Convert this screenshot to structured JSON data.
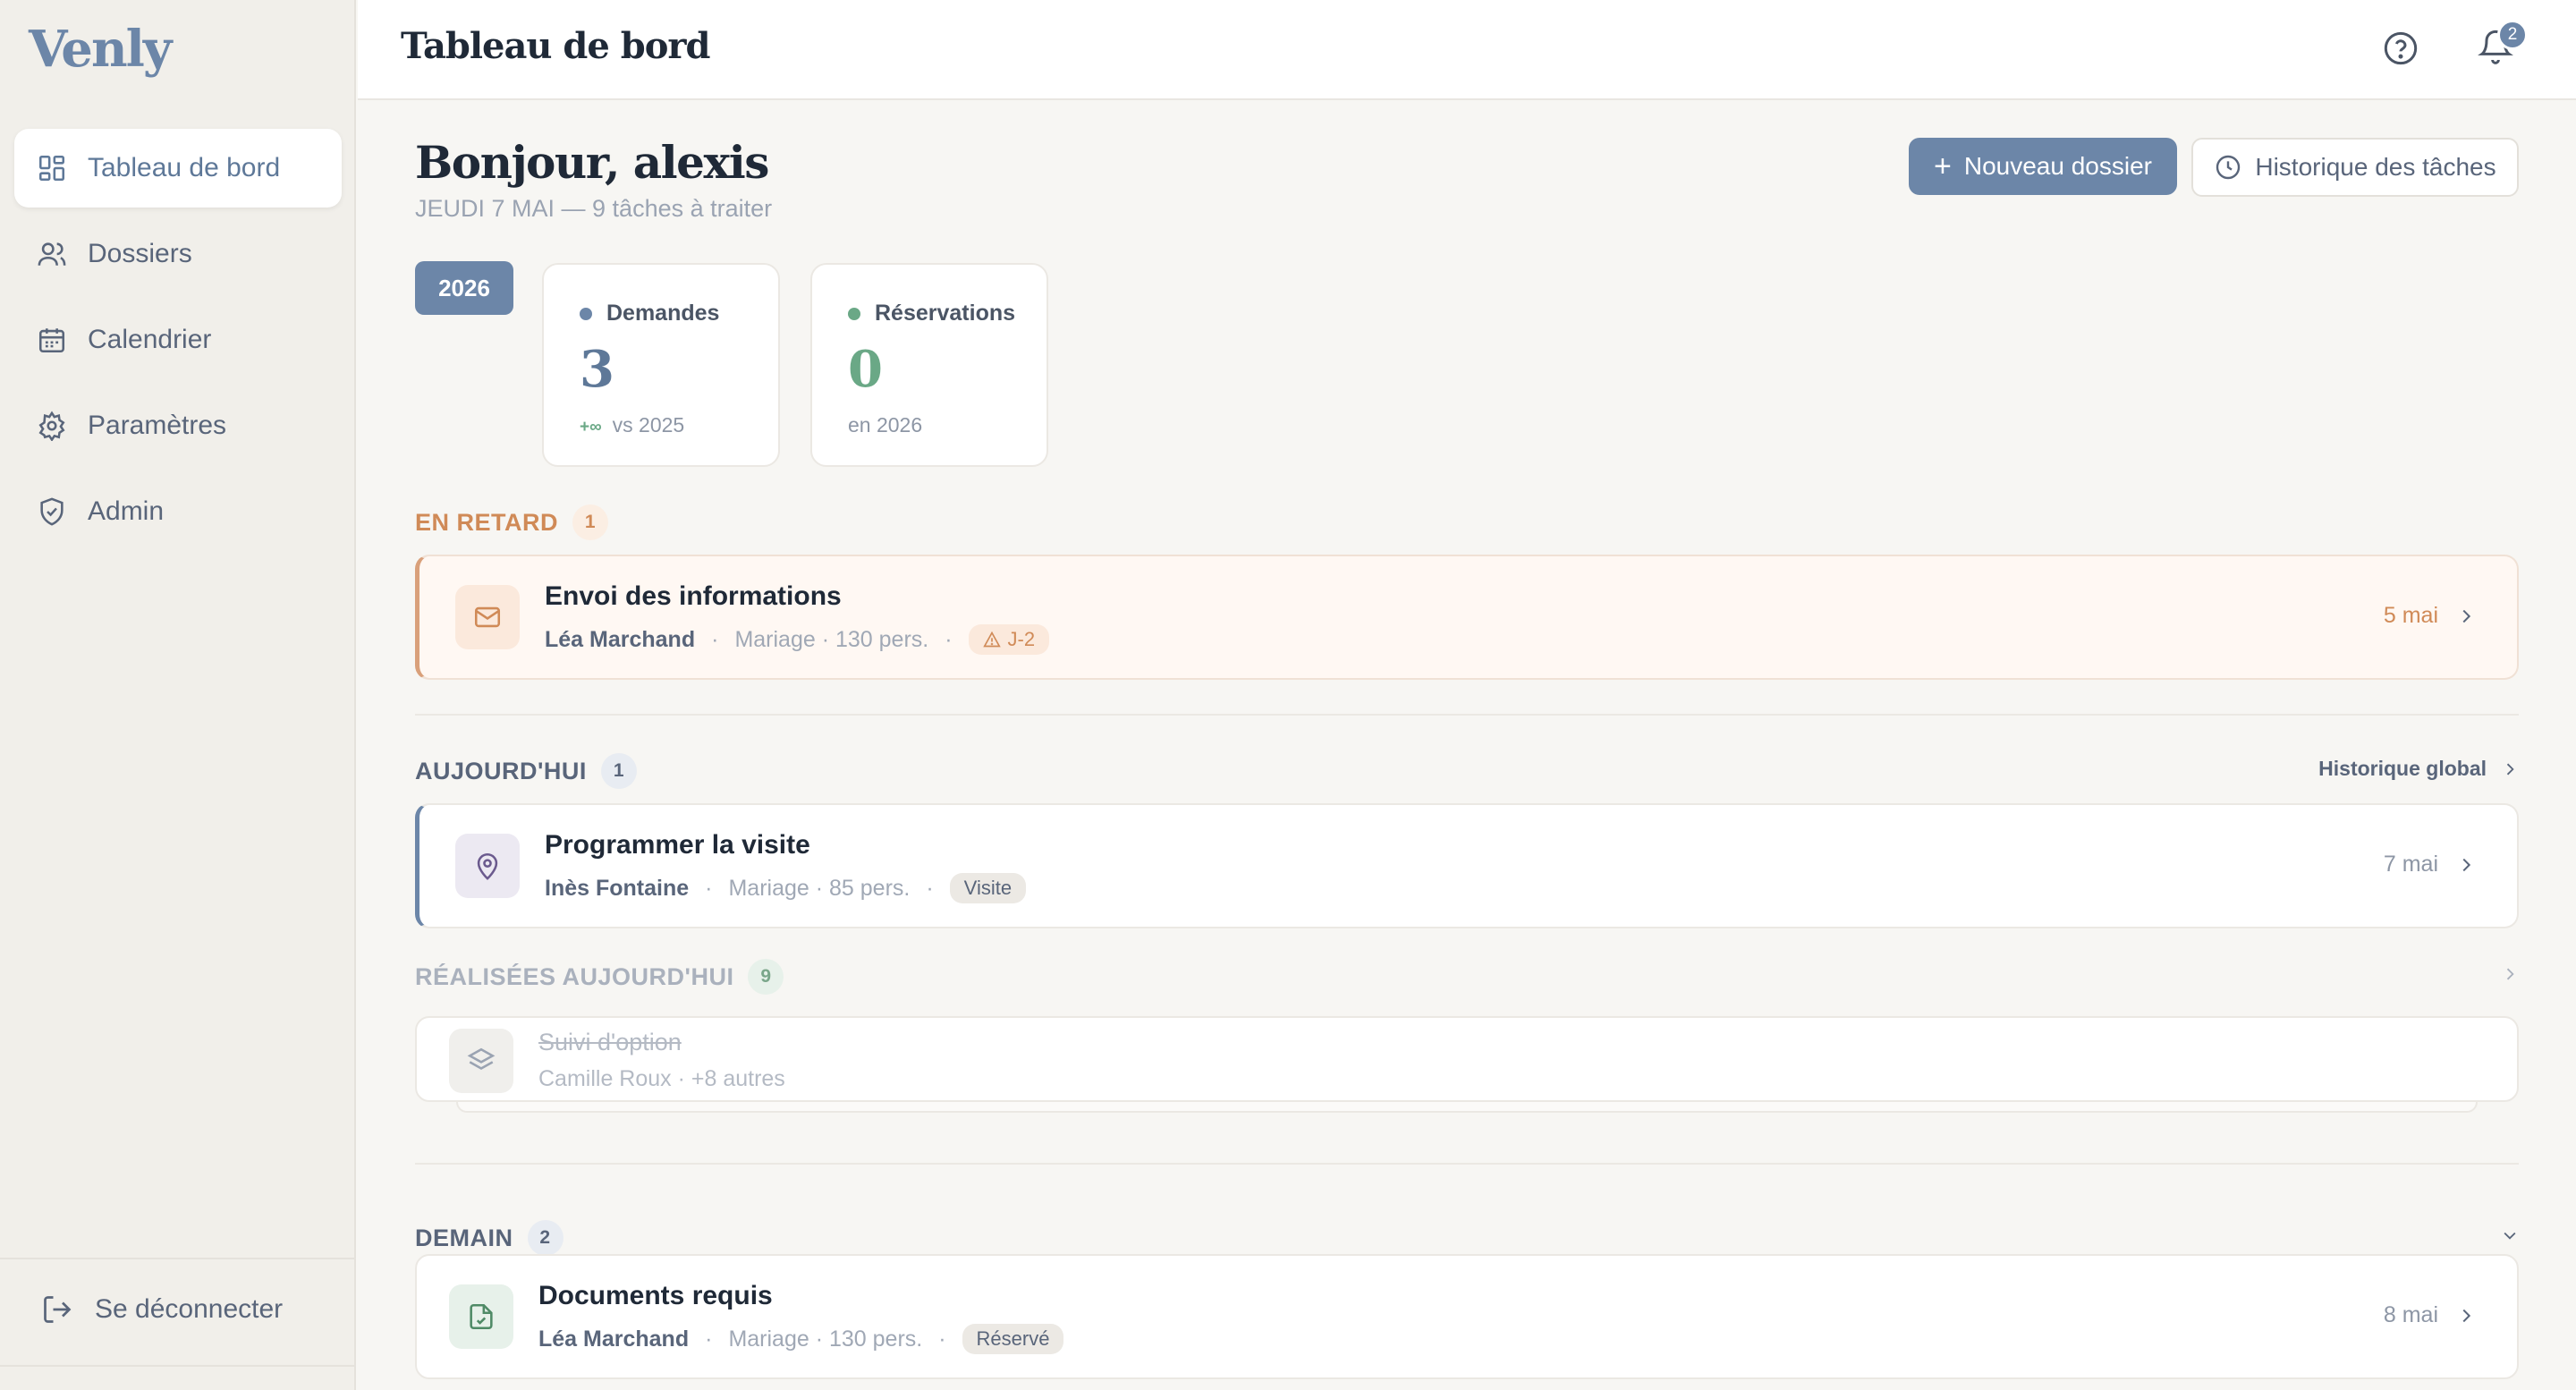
{
  "app": {
    "logo": "Venly"
  },
  "sidebar": {
    "items": [
      {
        "label": "Tableau de bord",
        "icon": "dashboard-icon",
        "active": true
      },
      {
        "label": "Dossiers",
        "icon": "users-icon",
        "active": false
      },
      {
        "label": "Calendrier",
        "icon": "calendar-icon",
        "active": false
      },
      {
        "label": "Paramètres",
        "icon": "gear-icon",
        "active": false
      },
      {
        "label": "Admin",
        "icon": "shield-icon",
        "active": false
      }
    ],
    "logout_label": "Se déconnecter"
  },
  "topbar": {
    "title": "Tableau de bord",
    "notifications_count": "2"
  },
  "header": {
    "greeting": "Bonjour, alexis",
    "subtitle": "JEUDI 7 MAI — 9 tâches à traiter",
    "new_button": "Nouveau dossier",
    "history_button": "Historique des tâches"
  },
  "stats": {
    "year": "2026",
    "demandes": {
      "label": "Demandes",
      "value": "3",
      "delta": "+∞",
      "foot": "vs 2025",
      "color": "#6c86a8"
    },
    "reservations": {
      "label": "Réservations",
      "value": "0",
      "foot": "en 2026",
      "color": "#6aa886"
    }
  },
  "sections": {
    "late": {
      "label": "EN RETARD",
      "count": "1",
      "task": {
        "title": "Envoi des informations",
        "person": "Léa Marchand",
        "details": "Mariage · 130 pers.",
        "tag": "J-2",
        "date": "5 mai"
      }
    },
    "today": {
      "label": "AUJOURD'HUI",
      "count": "1",
      "link": "Historique global",
      "task": {
        "title": "Programmer la visite",
        "person": "Inès Fontaine",
        "details": "Mariage · 85 pers.",
        "tag": "Visite",
        "date": "7 mai"
      }
    },
    "done": {
      "label": "RÉALISÉES AUJOURD'HUI",
      "count": "9",
      "task": {
        "title": "Suivi d'option",
        "meta": "Camille Roux · +8 autres"
      }
    },
    "tomorrow": {
      "label": "DEMAIN",
      "count": "2",
      "task": {
        "title": "Documents requis",
        "person": "Léa Marchand",
        "details": "Mariage · 130 pers.",
        "tag": "Réservé",
        "date": "8 mai"
      }
    }
  },
  "colors": {
    "accent": "#6c86a8",
    "late": "#d08a57",
    "success": "#6aa886"
  }
}
